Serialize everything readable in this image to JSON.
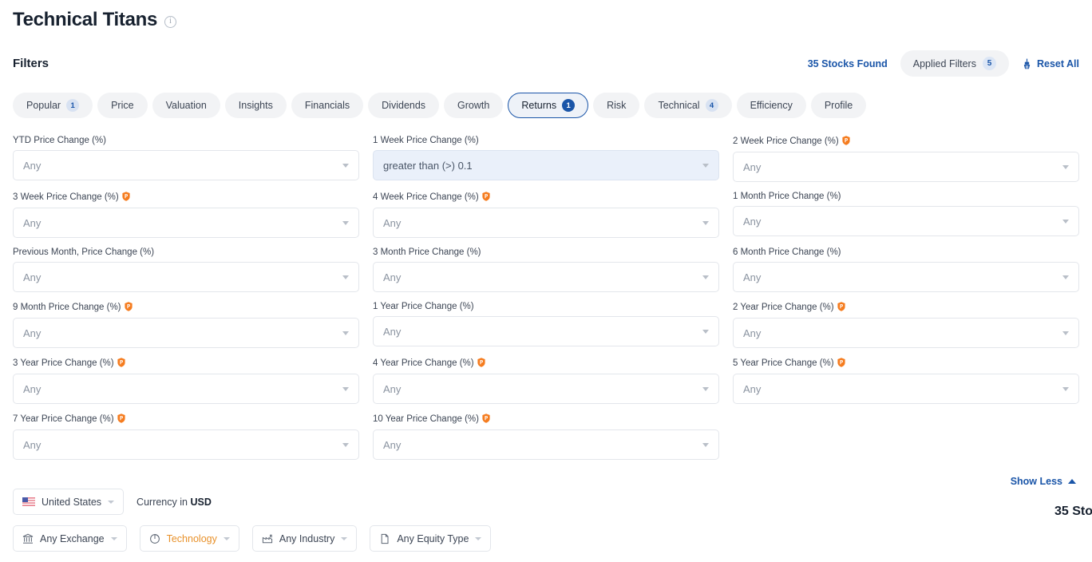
{
  "header": {
    "title": "Technical Titans",
    "info_icon": "info-icon"
  },
  "filters_bar": {
    "label": "Filters",
    "stocks_found": "35 Stocks Found",
    "applied_filters_label": "Applied Filters",
    "applied_filters_count": "5",
    "reset_all_label": "Reset All",
    "reset_icon": "broom-icon"
  },
  "tabs": [
    {
      "label": "Popular",
      "count": "1",
      "active": false
    },
    {
      "label": "Price",
      "count": "",
      "active": false
    },
    {
      "label": "Valuation",
      "count": "",
      "active": false
    },
    {
      "label": "Insights",
      "count": "",
      "active": false
    },
    {
      "label": "Financials",
      "count": "",
      "active": false
    },
    {
      "label": "Dividends",
      "count": "",
      "active": false
    },
    {
      "label": "Growth",
      "count": "",
      "active": false
    },
    {
      "label": "Returns",
      "count": "1",
      "active": true
    },
    {
      "label": "Risk",
      "count": "",
      "active": false
    },
    {
      "label": "Technical",
      "count": "4",
      "active": false
    },
    {
      "label": "Efficiency",
      "count": "",
      "active": false
    },
    {
      "label": "Profile",
      "count": "",
      "active": false
    }
  ],
  "fields": [
    {
      "label": "YTD Price Change (%)",
      "value": "Any",
      "pro": false,
      "filled": false
    },
    {
      "label": "1 Week Price Change (%)",
      "value": "greater than (>) 0.1",
      "pro": false,
      "filled": true
    },
    {
      "label": "2 Week Price Change (%)",
      "value": "Any",
      "pro": true,
      "filled": false
    },
    {
      "label": "3 Week Price Change (%)",
      "value": "Any",
      "pro": true,
      "filled": false
    },
    {
      "label": "4 Week Price Change (%)",
      "value": "Any",
      "pro": true,
      "filled": false
    },
    {
      "label": "1 Month Price Change (%)",
      "value": "Any",
      "pro": false,
      "filled": false
    },
    {
      "label": "Previous Month, Price Change (%)",
      "value": "Any",
      "pro": false,
      "filled": false
    },
    {
      "label": "3 Month Price Change (%)",
      "value": "Any",
      "pro": false,
      "filled": false
    },
    {
      "label": "6 Month Price Change (%)",
      "value": "Any",
      "pro": false,
      "filled": false
    },
    {
      "label": "9 Month Price Change (%)",
      "value": "Any",
      "pro": true,
      "filled": false
    },
    {
      "label": "1 Year Price Change (%)",
      "value": "Any",
      "pro": false,
      "filled": false
    },
    {
      "label": "2 Year Price Change (%)",
      "value": "Any",
      "pro": true,
      "filled": false
    },
    {
      "label": "3 Year Price Change (%)",
      "value": "Any",
      "pro": true,
      "filled": false
    },
    {
      "label": "4 Year Price Change (%)",
      "value": "Any",
      "pro": true,
      "filled": false
    },
    {
      "label": "5 Year Price Change (%)",
      "value": "Any",
      "pro": true,
      "filled": false
    },
    {
      "label": "7 Year Price Change (%)",
      "value": "Any",
      "pro": true,
      "filled": false
    },
    {
      "label": "10 Year Price Change (%)",
      "value": "Any",
      "pro": true,
      "filled": false
    }
  ],
  "show_less": {
    "label": "Show Less",
    "icon": "chevron-up-icon"
  },
  "bottom": {
    "country": "United States",
    "country_flag_icon": "us-flag-icon",
    "currency_prefix": "Currency in",
    "currency": "USD",
    "chips": [
      {
        "label": "Any Exchange",
        "icon": "bank-icon",
        "accent": false
      },
      {
        "label": "Technology",
        "icon": "pie-chart-icon",
        "accent": true
      },
      {
        "label": "Any Industry",
        "icon": "factory-icon",
        "accent": false
      },
      {
        "label": "Any Equity Type",
        "icon": "document-icon",
        "accent": false
      }
    ],
    "stocks_count_partial": "35 Sto"
  },
  "colors": {
    "accent_blue": "#1a55a8",
    "pro_orange": "#f57c1f",
    "sector_orange": "#e8912a",
    "text_dark": "#17212f",
    "text_muted": "#8a93a0",
    "border": "#e3e6eb"
  }
}
